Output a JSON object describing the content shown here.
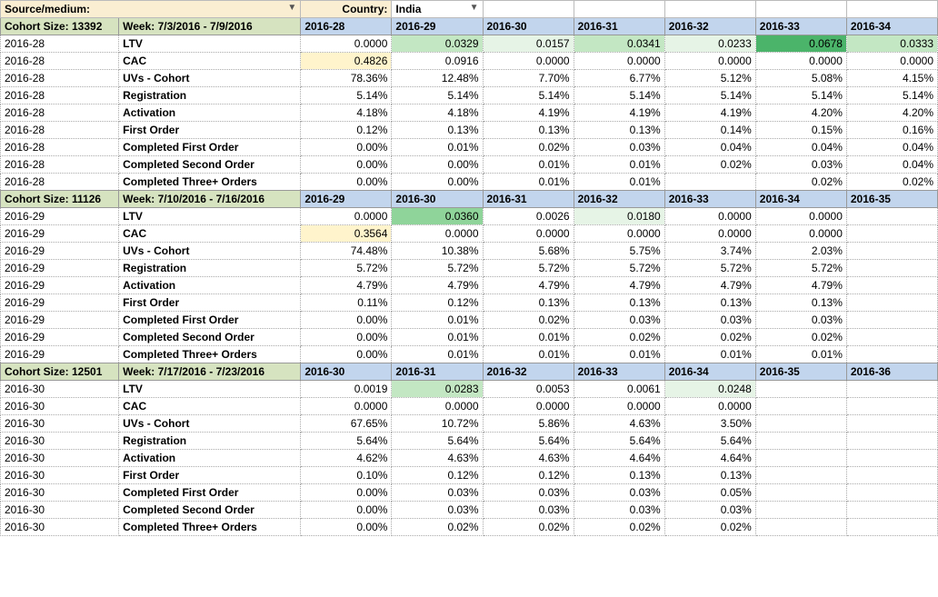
{
  "filters": {
    "sourceMediumLabel": "Source/medium:",
    "countryLabel": "Country:",
    "countryValue": "India"
  },
  "cohortSizePrefix": "Cohort Size: ",
  "weekPrefix": "Week: ",
  "metricLabels": [
    "LTV",
    "CAC",
    "UVs - Cohort",
    "Registration",
    "Activation",
    "First Order",
    "Completed First Order",
    "Completed Second Order",
    "Completed Three+ Orders"
  ],
  "sections": [
    {
      "cohortKey": "2016-28",
      "size": "13392",
      "weekRange": "7/3/2016 - 7/9/2016",
      "headers": [
        "2016-28",
        "2016-29",
        "2016-30",
        "2016-31",
        "2016-32",
        "2016-33",
        "2016-34"
      ],
      "rows": [
        {
          "cells": [
            {
              "v": "0.0000",
              "cls": ""
            },
            {
              "v": "0.0329",
              "cls": "bg-g2"
            },
            {
              "v": "0.0157",
              "cls": "bg-g1"
            },
            {
              "v": "0.0341",
              "cls": "bg-g2"
            },
            {
              "v": "0.0233",
              "cls": "bg-g1"
            },
            {
              "v": "0.0678",
              "cls": "bg-g4"
            },
            {
              "v": "0.0333",
              "cls": "bg-g2"
            }
          ]
        },
        {
          "cells": [
            {
              "v": "0.4826",
              "cls": "bg-yellow"
            },
            {
              "v": "0.0916",
              "cls": ""
            },
            {
              "v": "0.0000",
              "cls": ""
            },
            {
              "v": "0.0000",
              "cls": ""
            },
            {
              "v": "0.0000",
              "cls": ""
            },
            {
              "v": "0.0000",
              "cls": ""
            },
            {
              "v": "0.0000",
              "cls": ""
            }
          ]
        },
        {
          "cells": [
            {
              "v": "78.36%",
              "cls": ""
            },
            {
              "v": "12.48%",
              "cls": ""
            },
            {
              "v": "7.70%",
              "cls": ""
            },
            {
              "v": "6.77%",
              "cls": ""
            },
            {
              "v": "5.12%",
              "cls": ""
            },
            {
              "v": "5.08%",
              "cls": ""
            },
            {
              "v": "4.15%",
              "cls": ""
            }
          ]
        },
        {
          "cells": [
            {
              "v": "5.14%",
              "cls": ""
            },
            {
              "v": "5.14%",
              "cls": ""
            },
            {
              "v": "5.14%",
              "cls": ""
            },
            {
              "v": "5.14%",
              "cls": ""
            },
            {
              "v": "5.14%",
              "cls": ""
            },
            {
              "v": "5.14%",
              "cls": ""
            },
            {
              "v": "5.14%",
              "cls": ""
            }
          ]
        },
        {
          "cells": [
            {
              "v": "4.18%",
              "cls": ""
            },
            {
              "v": "4.18%",
              "cls": ""
            },
            {
              "v": "4.19%",
              "cls": ""
            },
            {
              "v": "4.19%",
              "cls": ""
            },
            {
              "v": "4.19%",
              "cls": ""
            },
            {
              "v": "4.20%",
              "cls": ""
            },
            {
              "v": "4.20%",
              "cls": ""
            }
          ]
        },
        {
          "cells": [
            {
              "v": "0.12%",
              "cls": ""
            },
            {
              "v": "0.13%",
              "cls": ""
            },
            {
              "v": "0.13%",
              "cls": ""
            },
            {
              "v": "0.13%",
              "cls": ""
            },
            {
              "v": "0.14%",
              "cls": ""
            },
            {
              "v": "0.15%",
              "cls": ""
            },
            {
              "v": "0.16%",
              "cls": ""
            }
          ]
        },
        {
          "cells": [
            {
              "v": "0.00%",
              "cls": ""
            },
            {
              "v": "0.01%",
              "cls": ""
            },
            {
              "v": "0.02%",
              "cls": ""
            },
            {
              "v": "0.03%",
              "cls": ""
            },
            {
              "v": "0.04%",
              "cls": ""
            },
            {
              "v": "0.04%",
              "cls": ""
            },
            {
              "v": "0.04%",
              "cls": ""
            }
          ]
        },
        {
          "cells": [
            {
              "v": "0.00%",
              "cls": ""
            },
            {
              "v": "0.00%",
              "cls": ""
            },
            {
              "v": "0.01%",
              "cls": ""
            },
            {
              "v": "0.01%",
              "cls": ""
            },
            {
              "v": "0.02%",
              "cls": ""
            },
            {
              "v": "0.03%",
              "cls": ""
            },
            {
              "v": "0.04%",
              "cls": ""
            }
          ]
        },
        {
          "cells": [
            {
              "v": "0.00%",
              "cls": ""
            },
            {
              "v": "0.00%",
              "cls": ""
            },
            {
              "v": "0.01%",
              "cls": ""
            },
            {
              "v": "0.01%",
              "cls": ""
            },
            {
              "v": "",
              "cls": ""
            },
            {
              "v": "0.02%",
              "cls": ""
            },
            {
              "v": "0.02%",
              "cls": ""
            }
          ]
        }
      ]
    },
    {
      "cohortKey": "2016-29",
      "size": "11126",
      "weekRange": "7/10/2016 - 7/16/2016",
      "headers": [
        "2016-29",
        "2016-30",
        "2016-31",
        "2016-32",
        "2016-33",
        "2016-34",
        "2016-35"
      ],
      "rows": [
        {
          "cells": [
            {
              "v": "0.0000",
              "cls": ""
            },
            {
              "v": "0.0360",
              "cls": "bg-g3"
            },
            {
              "v": "0.0026",
              "cls": ""
            },
            {
              "v": "0.0180",
              "cls": "bg-g1"
            },
            {
              "v": "0.0000",
              "cls": ""
            },
            {
              "v": "0.0000",
              "cls": ""
            },
            {
              "v": "",
              "cls": ""
            }
          ]
        },
        {
          "cells": [
            {
              "v": "0.3564",
              "cls": "bg-yellow"
            },
            {
              "v": "0.0000",
              "cls": ""
            },
            {
              "v": "0.0000",
              "cls": ""
            },
            {
              "v": "0.0000",
              "cls": ""
            },
            {
              "v": "0.0000",
              "cls": ""
            },
            {
              "v": "0.0000",
              "cls": ""
            },
            {
              "v": "",
              "cls": ""
            }
          ]
        },
        {
          "cells": [
            {
              "v": "74.48%",
              "cls": ""
            },
            {
              "v": "10.38%",
              "cls": ""
            },
            {
              "v": "5.68%",
              "cls": ""
            },
            {
              "v": "5.75%",
              "cls": ""
            },
            {
              "v": "3.74%",
              "cls": ""
            },
            {
              "v": "2.03%",
              "cls": ""
            },
            {
              "v": "",
              "cls": ""
            }
          ]
        },
        {
          "cells": [
            {
              "v": "5.72%",
              "cls": ""
            },
            {
              "v": "5.72%",
              "cls": ""
            },
            {
              "v": "5.72%",
              "cls": ""
            },
            {
              "v": "5.72%",
              "cls": ""
            },
            {
              "v": "5.72%",
              "cls": ""
            },
            {
              "v": "5.72%",
              "cls": ""
            },
            {
              "v": "",
              "cls": ""
            }
          ]
        },
        {
          "cells": [
            {
              "v": "4.79%",
              "cls": ""
            },
            {
              "v": "4.79%",
              "cls": ""
            },
            {
              "v": "4.79%",
              "cls": ""
            },
            {
              "v": "4.79%",
              "cls": ""
            },
            {
              "v": "4.79%",
              "cls": ""
            },
            {
              "v": "4.79%",
              "cls": ""
            },
            {
              "v": "",
              "cls": ""
            }
          ]
        },
        {
          "cells": [
            {
              "v": "0.11%",
              "cls": ""
            },
            {
              "v": "0.12%",
              "cls": ""
            },
            {
              "v": "0.13%",
              "cls": ""
            },
            {
              "v": "0.13%",
              "cls": ""
            },
            {
              "v": "0.13%",
              "cls": ""
            },
            {
              "v": "0.13%",
              "cls": ""
            },
            {
              "v": "",
              "cls": ""
            }
          ]
        },
        {
          "cells": [
            {
              "v": "0.00%",
              "cls": ""
            },
            {
              "v": "0.01%",
              "cls": ""
            },
            {
              "v": "0.02%",
              "cls": ""
            },
            {
              "v": "0.03%",
              "cls": ""
            },
            {
              "v": "0.03%",
              "cls": ""
            },
            {
              "v": "0.03%",
              "cls": ""
            },
            {
              "v": "",
              "cls": ""
            }
          ]
        },
        {
          "cells": [
            {
              "v": "0.00%",
              "cls": ""
            },
            {
              "v": "0.01%",
              "cls": ""
            },
            {
              "v": "0.01%",
              "cls": ""
            },
            {
              "v": "0.02%",
              "cls": ""
            },
            {
              "v": "0.02%",
              "cls": ""
            },
            {
              "v": "0.02%",
              "cls": ""
            },
            {
              "v": "",
              "cls": ""
            }
          ]
        },
        {
          "cells": [
            {
              "v": "0.00%",
              "cls": ""
            },
            {
              "v": "0.01%",
              "cls": ""
            },
            {
              "v": "0.01%",
              "cls": ""
            },
            {
              "v": "0.01%",
              "cls": ""
            },
            {
              "v": "0.01%",
              "cls": ""
            },
            {
              "v": "0.01%",
              "cls": ""
            },
            {
              "v": "",
              "cls": ""
            }
          ]
        }
      ]
    },
    {
      "cohortKey": "2016-30",
      "size": "12501",
      "weekRange": "7/17/2016 - 7/23/2016",
      "headers": [
        "2016-30",
        "2016-31",
        "2016-32",
        "2016-33",
        "2016-34",
        "2016-35",
        "2016-36"
      ],
      "rows": [
        {
          "cells": [
            {
              "v": "0.0019",
              "cls": ""
            },
            {
              "v": "0.0283",
              "cls": "bg-g2"
            },
            {
              "v": "0.0053",
              "cls": ""
            },
            {
              "v": "0.0061",
              "cls": ""
            },
            {
              "v": "0.0248",
              "cls": "bg-g1"
            },
            {
              "v": "",
              "cls": ""
            },
            {
              "v": "",
              "cls": ""
            }
          ]
        },
        {
          "cells": [
            {
              "v": "0.0000",
              "cls": ""
            },
            {
              "v": "0.0000",
              "cls": ""
            },
            {
              "v": "0.0000",
              "cls": ""
            },
            {
              "v": "0.0000",
              "cls": ""
            },
            {
              "v": "0.0000",
              "cls": ""
            },
            {
              "v": "",
              "cls": ""
            },
            {
              "v": "",
              "cls": ""
            }
          ]
        },
        {
          "cells": [
            {
              "v": "67.65%",
              "cls": ""
            },
            {
              "v": "10.72%",
              "cls": ""
            },
            {
              "v": "5.86%",
              "cls": ""
            },
            {
              "v": "4.63%",
              "cls": ""
            },
            {
              "v": "3.50%",
              "cls": ""
            },
            {
              "v": "",
              "cls": ""
            },
            {
              "v": "",
              "cls": ""
            }
          ]
        },
        {
          "cells": [
            {
              "v": "5.64%",
              "cls": ""
            },
            {
              "v": "5.64%",
              "cls": ""
            },
            {
              "v": "5.64%",
              "cls": ""
            },
            {
              "v": "5.64%",
              "cls": ""
            },
            {
              "v": "5.64%",
              "cls": ""
            },
            {
              "v": "",
              "cls": ""
            },
            {
              "v": "",
              "cls": ""
            }
          ]
        },
        {
          "cells": [
            {
              "v": "4.62%",
              "cls": ""
            },
            {
              "v": "4.63%",
              "cls": ""
            },
            {
              "v": "4.63%",
              "cls": ""
            },
            {
              "v": "4.64%",
              "cls": ""
            },
            {
              "v": "4.64%",
              "cls": ""
            },
            {
              "v": "",
              "cls": ""
            },
            {
              "v": "",
              "cls": ""
            }
          ]
        },
        {
          "cells": [
            {
              "v": "0.10%",
              "cls": ""
            },
            {
              "v": "0.12%",
              "cls": ""
            },
            {
              "v": "0.12%",
              "cls": ""
            },
            {
              "v": "0.13%",
              "cls": ""
            },
            {
              "v": "0.13%",
              "cls": ""
            },
            {
              "v": "",
              "cls": ""
            },
            {
              "v": "",
              "cls": ""
            }
          ]
        },
        {
          "cells": [
            {
              "v": "0.00%",
              "cls": ""
            },
            {
              "v": "0.03%",
              "cls": ""
            },
            {
              "v": "0.03%",
              "cls": ""
            },
            {
              "v": "0.03%",
              "cls": ""
            },
            {
              "v": "0.05%",
              "cls": ""
            },
            {
              "v": "",
              "cls": ""
            },
            {
              "v": "",
              "cls": ""
            }
          ]
        },
        {
          "cells": [
            {
              "v": "0.00%",
              "cls": ""
            },
            {
              "v": "0.03%",
              "cls": ""
            },
            {
              "v": "0.03%",
              "cls": ""
            },
            {
              "v": "0.03%",
              "cls": ""
            },
            {
              "v": "0.03%",
              "cls": ""
            },
            {
              "v": "",
              "cls": ""
            },
            {
              "v": "",
              "cls": ""
            }
          ]
        },
        {
          "cells": [
            {
              "v": "0.00%",
              "cls": ""
            },
            {
              "v": "0.02%",
              "cls": ""
            },
            {
              "v": "0.02%",
              "cls": ""
            },
            {
              "v": "0.02%",
              "cls": ""
            },
            {
              "v": "0.02%",
              "cls": ""
            },
            {
              "v": "",
              "cls": ""
            },
            {
              "v": "",
              "cls": ""
            }
          ]
        }
      ]
    }
  ]
}
